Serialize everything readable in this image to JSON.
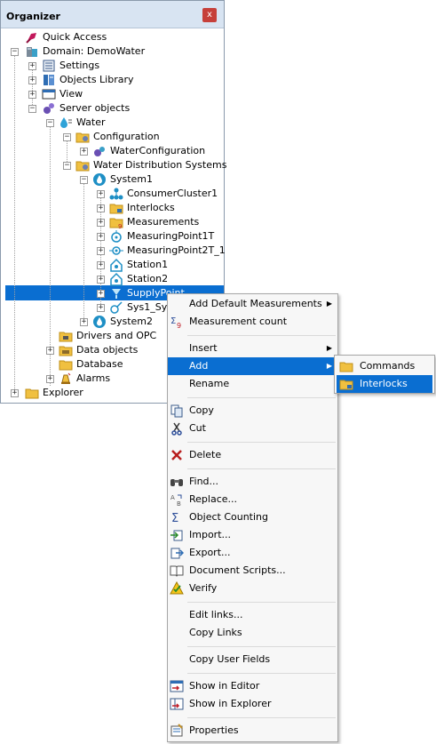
{
  "organizer": {
    "title": "Organizer",
    "close": "x"
  },
  "tree": [
    {
      "label": "Quick Access",
      "icon": "quick-access-icon"
    },
    {
      "label": "Domain: DemoWater",
      "icon": "domain-icon"
    },
    {
      "label": "Settings",
      "icon": "settings-icon"
    },
    {
      "label": "Objects Library",
      "icon": "library-icon"
    },
    {
      "label": "View",
      "icon": "view-icon"
    },
    {
      "label": "Server objects",
      "icon": "server-objects-icon"
    },
    {
      "label": "Water",
      "icon": "water-icon"
    },
    {
      "label": "Configuration",
      "icon": "folder-config-icon"
    },
    {
      "label": "WaterConfiguration",
      "icon": "gears-icon"
    },
    {
      "label": "Water Distribution Systems",
      "icon": "folder-config-icon"
    },
    {
      "label": "System1",
      "icon": "water-system-icon"
    },
    {
      "label": "ConsumerCluster1",
      "icon": "cluster-icon"
    },
    {
      "label": "Interlocks",
      "icon": "folder-lock-icon"
    },
    {
      "label": "Measurements",
      "icon": "folder-measure-icon"
    },
    {
      "label": "MeasuringPoint1T",
      "icon": "measuring-point-icon"
    },
    {
      "label": "MeasuringPoint2T_1",
      "icon": "measuring-point-icon"
    },
    {
      "label": "Station1",
      "icon": "station-icon"
    },
    {
      "label": "Station2",
      "icon": "station-icon"
    },
    {
      "label": "SupplyPoint",
      "icon": "supply-point-icon"
    },
    {
      "label": "Sys1_Sy",
      "icon": "link-icon"
    },
    {
      "label": "System2",
      "icon": "water-system-icon"
    },
    {
      "label": "Drivers and OPC",
      "icon": "drivers-icon"
    },
    {
      "label": "Data objects",
      "icon": "data-objects-icon"
    },
    {
      "label": "Database",
      "icon": "database-icon"
    },
    {
      "label": "Alarms",
      "icon": "alarms-icon"
    },
    {
      "label": "Explorer",
      "icon": "folder-icon"
    }
  ],
  "context_menu": {
    "items": [
      {
        "label": "Add Default Measurements",
        "submenu": true,
        "icon": ""
      },
      {
        "label": "Measurement count",
        "icon": "sigma-count-icon"
      },
      {
        "label": "Insert",
        "submenu": true,
        "icon": ""
      },
      {
        "label": "Add",
        "submenu": true,
        "icon": ""
      },
      {
        "label": "Rename",
        "icon": ""
      },
      {
        "label": "Copy",
        "icon": "copy-icon"
      },
      {
        "label": "Cut",
        "icon": "cut-icon"
      },
      {
        "label": "Delete",
        "icon": "delete-icon"
      },
      {
        "label": "Find...",
        "icon": "find-icon"
      },
      {
        "label": "Replace...",
        "icon": "replace-icon"
      },
      {
        "label": "Object Counting",
        "icon": "sigma-icon"
      },
      {
        "label": "Import...",
        "icon": "import-icon"
      },
      {
        "label": "Export...",
        "icon": "export-icon"
      },
      {
        "label": "Document Scripts...",
        "icon": "book-icon"
      },
      {
        "label": "Verify",
        "icon": "verify-icon"
      },
      {
        "label": "Edit links...",
        "icon": ""
      },
      {
        "label": "Copy Links",
        "icon": ""
      },
      {
        "label": "Copy User Fields",
        "icon": ""
      },
      {
        "label": "Show in Editor",
        "icon": "show-editor-icon"
      },
      {
        "label": "Show in Explorer",
        "icon": "show-explorer-icon"
      },
      {
        "label": "Properties",
        "icon": "properties-icon"
      }
    ],
    "submenu_arrow": "▶"
  },
  "add_submenu": {
    "items": [
      {
        "label": "Commands",
        "icon": "folder-commands-icon"
      },
      {
        "label": "Interlocks",
        "icon": "folder-interlocks-icon"
      }
    ]
  },
  "colors": {
    "selection": "#0a6ed1",
    "title_bar": "#d8e4f2",
    "close_button": "#c6403a"
  }
}
